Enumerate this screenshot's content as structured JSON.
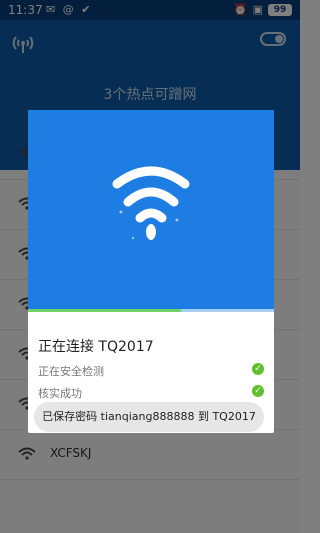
{
  "status_bar": {
    "time": "11:37",
    "battery": "99",
    "left_icons": [
      "message-icon",
      "at-icon",
      "check-circle-icon"
    ],
    "right_icons": [
      "alarm-icon",
      "no-sim-icon",
      "battery-icon"
    ]
  },
  "header": {
    "hotspot_count_text": "3个热点可蹭网",
    "toggle_state": "on"
  },
  "list": {
    "rows": [
      {
        "name": ""
      },
      {
        "name": ""
      },
      {
        "name": ""
      },
      {
        "name": ""
      },
      {
        "name": ""
      },
      {
        "name": ""
      },
      {
        "name": "XCFSKJ"
      }
    ]
  },
  "dialog": {
    "title": "正在连接 TQ2017",
    "progress": 0.62,
    "steps": [
      {
        "label": "正在安全检测",
        "done": true
      },
      {
        "label": "核实成功",
        "done": true
      }
    ]
  },
  "toast": {
    "text": "已保存密码 tianqiang888888 到 TQ2017"
  },
  "colors": {
    "header": "#0c5aa6",
    "dialog_accent": "#1d7de3",
    "success": "#5ec12b"
  }
}
